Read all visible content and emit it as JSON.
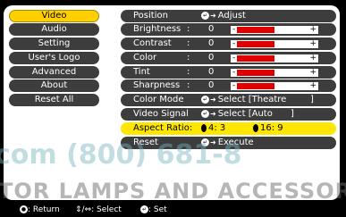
{
  "left_menu": [
    {
      "label": "Video",
      "active": true
    },
    {
      "label": "Audio",
      "active": false
    },
    {
      "label": "Setting",
      "active": false
    },
    {
      "label": "User's Logo",
      "active": false
    },
    {
      "label": "Advanced",
      "active": false
    },
    {
      "label": "About",
      "active": false
    },
    {
      "label": "Reset All",
      "active": false
    }
  ],
  "settings": {
    "position": {
      "label": "Position",
      "action": "Adjust"
    },
    "brightness": {
      "label": "Brightness",
      "colon": ":",
      "value": "0",
      "level": 0.5
    },
    "contrast": {
      "label": "Contrast",
      "colon": ":",
      "value": "0",
      "level": 0.5
    },
    "color": {
      "label": "Color",
      "colon": ":",
      "value": "0",
      "level": 0.5
    },
    "tint": {
      "label": "Tint",
      "colon": ":",
      "value": "0",
      "level": 0.5
    },
    "sharpness": {
      "label": "Sharpness",
      "colon": ":",
      "value": "0",
      "level": 0.5
    },
    "color_mode": {
      "label": "Color Mode",
      "action": "Select [Theatre",
      "close": "]"
    },
    "video_signal": {
      "label": "Video Signal",
      "action": "Select [Auto",
      "close": "]"
    },
    "aspect_ratio": {
      "label": "Aspect Ratio:",
      "option1": "4: 3",
      "option2": "16: 9"
    },
    "reset": {
      "label": "Reset",
      "action": "Execute"
    }
  },
  "watermark": {
    "line1": "com (800) 681-8",
    "line2": "TOR LAMPS AND ACCESSORI"
  },
  "footer": {
    "return_label": ": Return",
    "select_label": ": Select",
    "set_label": ": Set"
  },
  "colors": {
    "active_menu": "#ffd000",
    "highlight_row": "#ffe600",
    "slider_fill": "#e00000",
    "pill": "#3d3d3d"
  }
}
